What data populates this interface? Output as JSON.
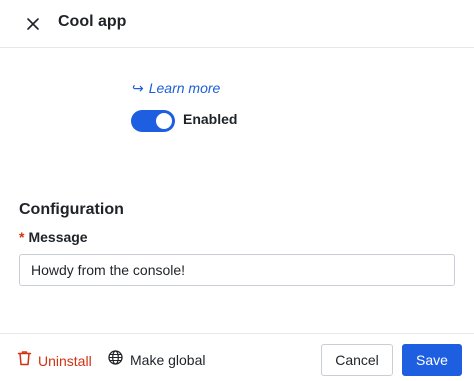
{
  "header": {
    "title": "Cool app",
    "close_icon": "close-icon"
  },
  "main": {
    "learn_more": {
      "arrow": "↪",
      "label": "Learn more"
    },
    "toggle": {
      "label": "Enabled",
      "on": true,
      "accent_color": "#1d5fe0"
    },
    "configuration": {
      "title": "Configuration",
      "field": {
        "required_mark": "*",
        "label": "Message",
        "value": "Howdy from the console!"
      }
    }
  },
  "footer": {
    "uninstall": {
      "label": "Uninstall",
      "icon": "trash-icon",
      "color": "#d13212"
    },
    "make_global": {
      "label": "Make global",
      "icon": "globe-icon"
    },
    "cancel_label": "Cancel",
    "save_label": "Save"
  }
}
